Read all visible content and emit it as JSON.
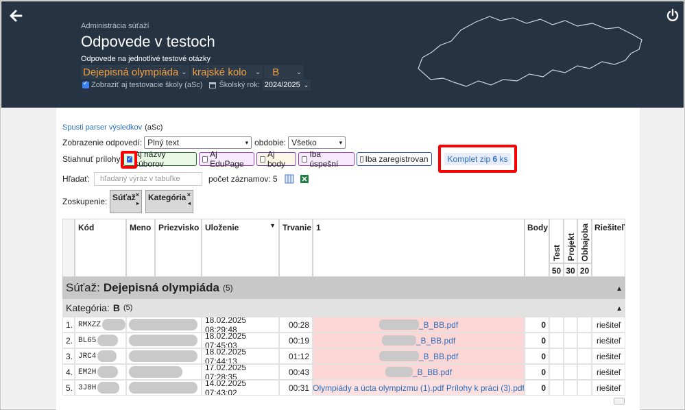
{
  "header": {
    "context": "Administrácia súťaží",
    "title": "Odpovede v testoch",
    "subtitle": "Odpovede na jednotlivé testové otázky",
    "competition": "Dejepisná olympiáda",
    "round": "krajské kolo",
    "category": "B",
    "show_test_schools": "Zobraziť aj testovacie školy (aSc)",
    "school_year_label": "Školský rok:",
    "school_year": "2024/2025"
  },
  "toolbar": {
    "parser_link": "Spusti parser výsledkov",
    "parser_suffix": "(aSc)",
    "display_label": "Zobrazenie odpovedí:",
    "display_value": "Plný text",
    "period_label": "obdobie:",
    "period_value": "Všetko",
    "download_label": "Stiahnuť prílohy",
    "chips": [
      "Aj názvy súborov",
      "Aj EduPage",
      "Aj body",
      "Iba úspešní",
      "Iba zaregistrovan"
    ],
    "komplet_prefix": "Komplet zip",
    "komplet_count": "6",
    "komplet_suffix": "ks",
    "search_label": "Hľadať:",
    "search_placeholder": "hľadaný výraz v tabuľke",
    "record_count": "počet záznamov: 5",
    "grouping_label": "Zoskupenie:",
    "groups": [
      "Súťaž",
      "Kategória"
    ]
  },
  "table": {
    "columns": [
      "Kód",
      "Meno",
      "Priezvisko",
      "Uloženie",
      "Trvanie",
      "1",
      "Body",
      "Test",
      "Projekt",
      "Obhajoba",
      "Riešiteľ"
    ],
    "max_points": [
      "50",
      "30",
      "20"
    ],
    "group1_label": "Súťaž:",
    "group1_value": "Dejepisná olympiáda",
    "group1_count": "(5)",
    "group2_label": "Kategória:",
    "group2_value": "B",
    "group2_count": "(5)",
    "rows": [
      {
        "n": "1.",
        "code": "RMXZZ",
        "saved": "18.02.2025 08:29:48",
        "duration": "00:28",
        "file": "_B_BB.pdf",
        "points": "0",
        "role": "riešiteľ"
      },
      {
        "n": "2.",
        "code": "BL65",
        "saved": "18.02.2025 07:45:03",
        "duration": "00:19",
        "file": "_B_BB.pdf",
        "points": "0",
        "role": "riešiteľ"
      },
      {
        "n": "3.",
        "code": "JRC4",
        "saved": "18.02.2025 07:44:13",
        "duration": "01:12",
        "file": "_B_BB.pdf",
        "points": "0",
        "role": "riešiteľ"
      },
      {
        "n": "4.",
        "code": "EM2H",
        "saved": "17.02.2025 07:28:35",
        "duration": "00:43",
        "file": "_B_BB.pdf",
        "points": "0",
        "role": "riešiteľ"
      },
      {
        "n": "5.",
        "code": "3J8H",
        "saved": "14.02.2025 07:43:02",
        "duration": "00:31",
        "file": "Olympiády a úcta olympizmu (1).pdf Prílohy k práci (3).pdf",
        "points": "0",
        "role": "riešiteľ"
      }
    ]
  }
}
